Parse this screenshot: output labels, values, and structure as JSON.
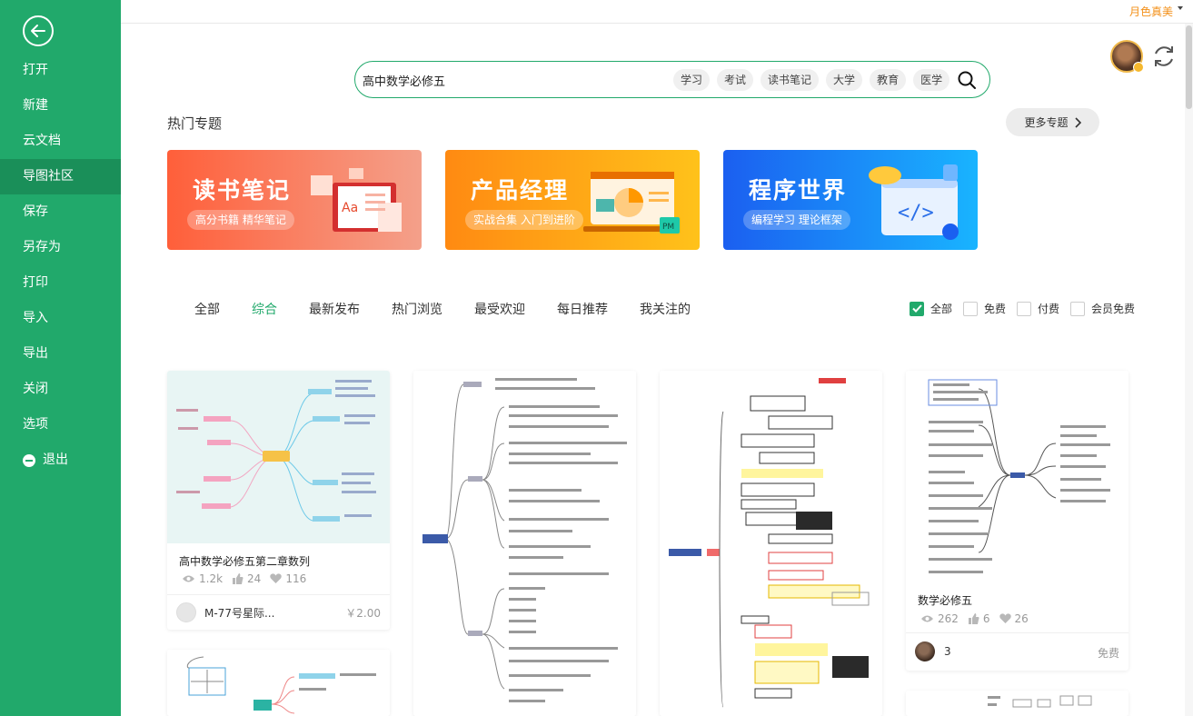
{
  "sidebar": {
    "items": [
      {
        "label": "打开"
      },
      {
        "label": "新建"
      },
      {
        "label": "云文档"
      },
      {
        "label": "导图社区"
      },
      {
        "label": "保存"
      },
      {
        "label": "另存为"
      },
      {
        "label": "打印"
      },
      {
        "label": "导入"
      },
      {
        "label": "导出"
      },
      {
        "label": "关闭"
      },
      {
        "label": "选项"
      },
      {
        "label": "退出"
      }
    ],
    "active": "导图社区"
  },
  "user": {
    "name": "月色真美"
  },
  "search": {
    "value": "高中数学必修五",
    "tags": [
      "学习",
      "考试",
      "读书笔记",
      "大学",
      "教育",
      "医学"
    ]
  },
  "hot": {
    "title": "热门专题",
    "more": "更多专题",
    "banners": [
      {
        "title": "读书笔记",
        "sub": "高分书籍 精华笔记",
        "art_text": "Aa"
      },
      {
        "title": "产品经理",
        "sub": "实战合集 入门到进阶",
        "art_text": "PM"
      },
      {
        "title": "程序世界",
        "sub": "编程学习 理论框架",
        "art_text": "</>"
      }
    ]
  },
  "tabs": [
    "全部",
    "综合",
    "最新发布",
    "热门浏览",
    "最受欢迎",
    "每日推荐",
    "我关注的"
  ],
  "active_tab": "综合",
  "filters": [
    {
      "label": "全部",
      "checked": true
    },
    {
      "label": "免费",
      "checked": false
    },
    {
      "label": "付费",
      "checked": false
    },
    {
      "label": "会员免费",
      "checked": false
    }
  ],
  "cards": [
    {
      "title": "高中数学必修五第二章数列",
      "views": "1.2k",
      "likes": "24",
      "favs": "116",
      "author": "M-77号星际...",
      "price": "￥2.00"
    },
    {
      "title": "数学必修五",
      "views": "262",
      "likes": "6",
      "favs": "26",
      "author": "3",
      "price": "免费"
    }
  ],
  "colors": {
    "accent": "#21a96b",
    "user": "#f39019"
  }
}
